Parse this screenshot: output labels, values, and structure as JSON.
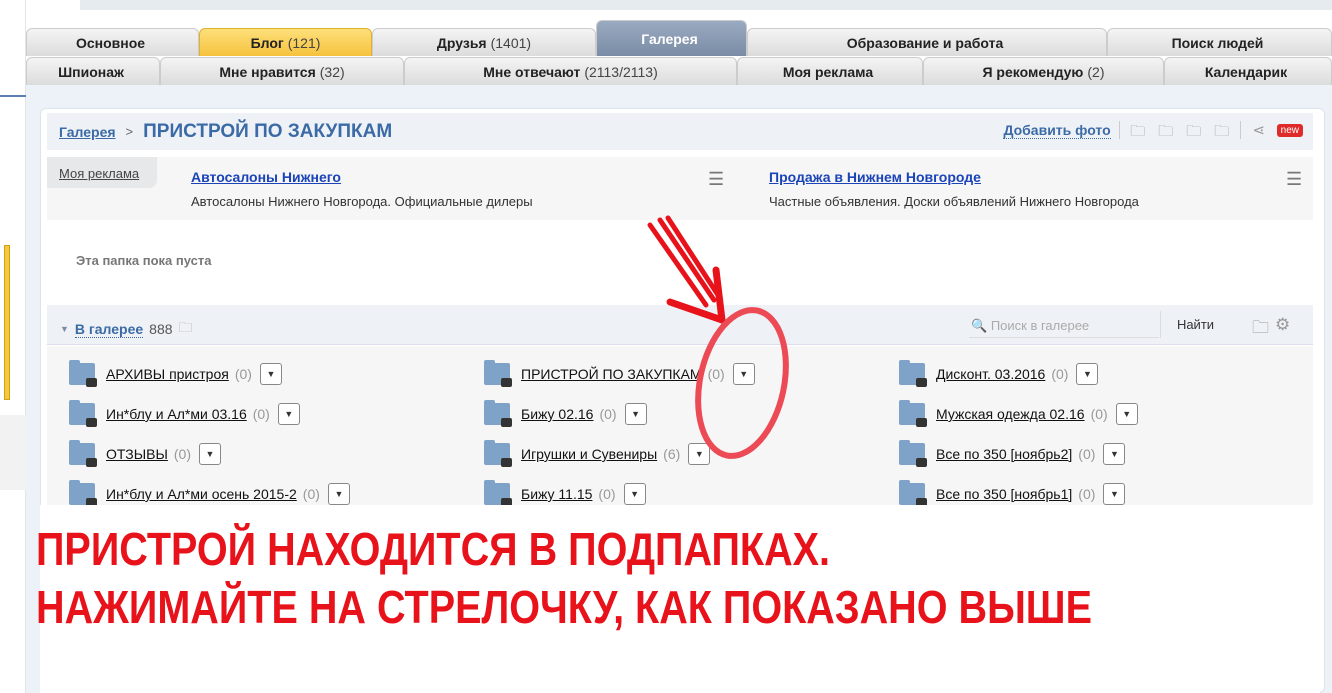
{
  "tabs_row1": [
    {
      "label": "Основное",
      "count": ""
    },
    {
      "label": "Блог",
      "count": "(121)"
    },
    {
      "label": "Друзья",
      "count": "(1401)"
    },
    {
      "label": "Галерея",
      "count": ""
    },
    {
      "label": "Образование и работа",
      "count": ""
    },
    {
      "label": "Поиск людей",
      "count": ""
    }
  ],
  "tabs_row2": [
    {
      "label": "Шпионаж",
      "count": ""
    },
    {
      "label": "Мне нравится",
      "count": "(32)"
    },
    {
      "label": "Мне отвечают",
      "count": "(2113/2113)"
    },
    {
      "label": "Моя реклама",
      "count": ""
    },
    {
      "label": "Я рекомендую",
      "count": "(2)"
    },
    {
      "label": "Календарик",
      "count": ""
    }
  ],
  "header": {
    "breadcrumb": "Галерея",
    "separator": ">",
    "title": "ПРИСТРОЙ ПО ЗАКУПКАМ",
    "add_photo": "Добавить фото",
    "new_badge": "new"
  },
  "ads": {
    "tab": "Моя реклама",
    "items": [
      {
        "title": "Автосалоны Нижнего",
        "desc": "Автосалоны Нижнего Новгорода. Официальные дилеры"
      },
      {
        "title": "Продажа в Нижнем Новгороде",
        "desc": "Частные объявления. Доски объявлений Нижнего Новгорода"
      }
    ]
  },
  "empty_text": "Эта папка пока пуста",
  "gallery": {
    "title": "В галерее",
    "count": "888",
    "search_placeholder": "Поиск в галерее",
    "find_button": "Найти"
  },
  "folders": [
    {
      "name": "АРХИВЫ пристроя",
      "count": "(0)"
    },
    {
      "name": "ПРИСТРОЙ ПО ЗАКУПКАМ",
      "count": "(0)"
    },
    {
      "name": "Дисконт. 03.2016",
      "count": "(0)"
    },
    {
      "name": "Ин*блу и Ал*ми 03.16",
      "count": "(0)"
    },
    {
      "name": "Бижу 02.16",
      "count": "(0)"
    },
    {
      "name": "Мужская одежда 02.16",
      "count": "(0)"
    },
    {
      "name": "ОТЗЫВЫ",
      "count": "(0)"
    },
    {
      "name": "Игрушки и Сувениры",
      "count": "(6)"
    },
    {
      "name": "Все по 350 [ноябрь2]",
      "count": "(0)"
    },
    {
      "name": "Ин*блу и Ал*ми осень 2015-2",
      "count": "(0)"
    },
    {
      "name": "Бижу 11.15",
      "count": "(0)"
    },
    {
      "name": "Все по 350 [ноябрь1]",
      "count": "(0)"
    }
  ],
  "annotation": {
    "line1": "ПРИСТРОЙ НАХОДИТСЯ В ПОДПАПКАХ.",
    "line2": "НАЖИМАЙТЕ НА СТРЕЛОЧКУ, КАК ПОКАЗАНО ВЫШЕ",
    "color": "#e8121a"
  }
}
